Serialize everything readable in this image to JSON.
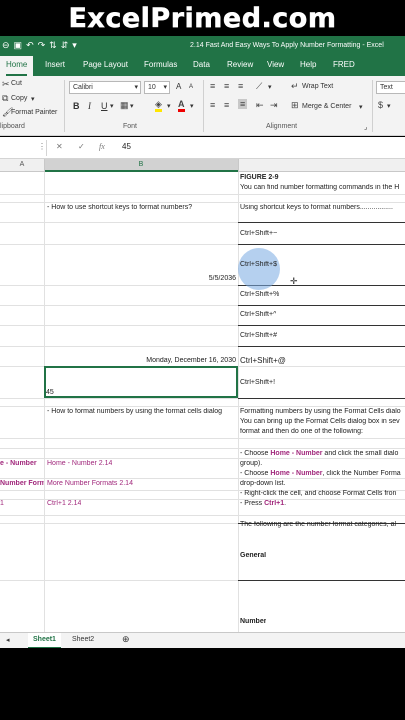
{
  "banner": {
    "text": "ExcelPrimed.com"
  },
  "titlebar": {
    "title": "2.14 Fast And Easy Ways To Apply Number Formatting  -  Excel"
  },
  "tabs": [
    "Home",
    "Insert",
    "Page Layout",
    "Formulas",
    "Data",
    "Review",
    "View",
    "Help",
    "FRED"
  ],
  "ribbon": {
    "clipboard": {
      "cut": "Cut",
      "copy": "Copy",
      "format_painter": "Format Painter",
      "label": "lipboard"
    },
    "font": {
      "name": "Calibri",
      "size": "10",
      "bold": "B",
      "italic": "I",
      "underline": "U",
      "grow": "A",
      "shrink": "A",
      "label": "Font"
    },
    "alignment": {
      "wrap": "Wrap Text",
      "merge": "Merge & Center",
      "label": "Alignment"
    },
    "number": {
      "format": "Text"
    }
  },
  "formula_bar": {
    "cancel": "✕",
    "enter": "✓",
    "fx": "fx",
    "value": "45"
  },
  "columns": {
    "a": "A",
    "b": "B"
  },
  "cells": {
    "figure": "FIGURE 2-9",
    "intro": "You can find number formatting commands in the H",
    "shortcut_q": "- How to use shortcut keys to format numbers?",
    "shortcut_head": "Using shortcut keys to format numbers.................",
    "k1": "Ctrl+Shift+~",
    "k2": "Ctrl+Shift+$",
    "date1": "5/5/2036",
    "k3": "Ctrl+Shift+%",
    "k4": "Ctrl+Shift+^",
    "k5": "Ctrl+Shift+#",
    "date2": "Monday, December 16, 2030",
    "k6": "Ctrl+Shift+@",
    "k7": "Ctrl+Shift+!",
    "num45": "45",
    "dialog_q": "- How to format numbers by using the format cells dialog",
    "dialog_head": "Formatting numbers by using the Format Cells dialo",
    "dialog_l2": "You can bring up the Format Cells dialog box in sev",
    "dialog_l3": "format and then do one of the following:",
    "a_home": "e - Number",
    "b_home": "Home - Number 2.14",
    "c_choose_pre": "- Choose ",
    "c_choose_hl": "Home - Number",
    "c_choose_post": " and click the small dialo",
    "c_group": "group).",
    "a_more": "Number Form",
    "b_more": "More Number Formats 2.14",
    "c_more_pre": "- Choose ",
    "c_more_hl": "Home - Number",
    "c_more_post": ", click the Number Forma",
    "c_dropdown": "drop-down list.",
    "c_right": "- Right-click the cell, and choose Format Cells fron",
    "a_ctrl": "1",
    "b_ctrl": "Ctrl+1 2.14",
    "c_press_pre": "- Press ",
    "c_press_hl": "Ctrl+1",
    "c_press_post": ".",
    "categories": "The following are the number format categories, al",
    "general": "General",
    "number": "Number"
  },
  "sheets": [
    "Sheet1",
    "Sheet2"
  ],
  "add_sheet": "⊕",
  "colors": {
    "excel_green": "#217346",
    "highlight": "#a1287c"
  }
}
